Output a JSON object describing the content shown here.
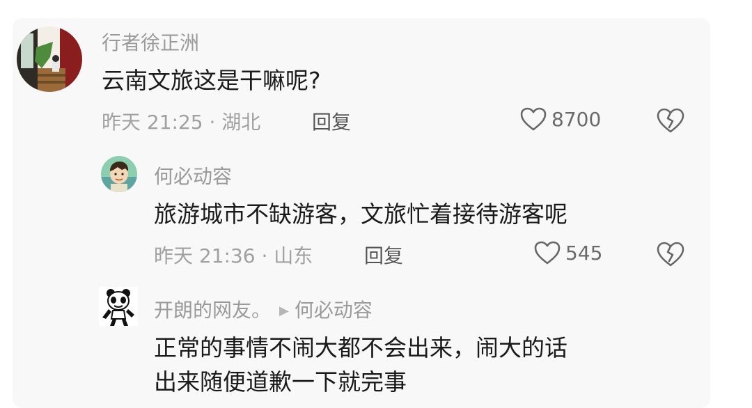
{
  "comments": [
    {
      "username": "行者徐正洲",
      "text_lines": [
        "云南文旅这是干嘛呢?"
      ],
      "time_location": "昨天 21:25 · 湖北",
      "reply_label": "回复",
      "likes": "8700",
      "avatar": "avatar-photo"
    },
    {
      "username": "何必动容",
      "text_lines": [
        "旅游城市不缺游客，文旅忙着接待游客呢"
      ],
      "time_location": "昨天 21:36 · 山东",
      "reply_label": "回复",
      "likes": "545",
      "avatar": "avatar-cartoon"
    },
    {
      "username": "开朗的网友。",
      "reply_to": "何必动容",
      "text_lines": [
        "正常的事情不闹大都不会出来，闹大的话",
        "出来随便道歉一下就完事"
      ],
      "avatar": "panda-meme-avatar"
    }
  ],
  "icons": {
    "like": "heart-outline-icon",
    "dislike": "broken-heart-icon",
    "reply_arrow": "triangle-right-icon"
  },
  "colors": {
    "card_background": "#f8f8f8",
    "username": "#9a9a9a",
    "content": "#1a1a1a",
    "meta": "#a0a0a0"
  }
}
